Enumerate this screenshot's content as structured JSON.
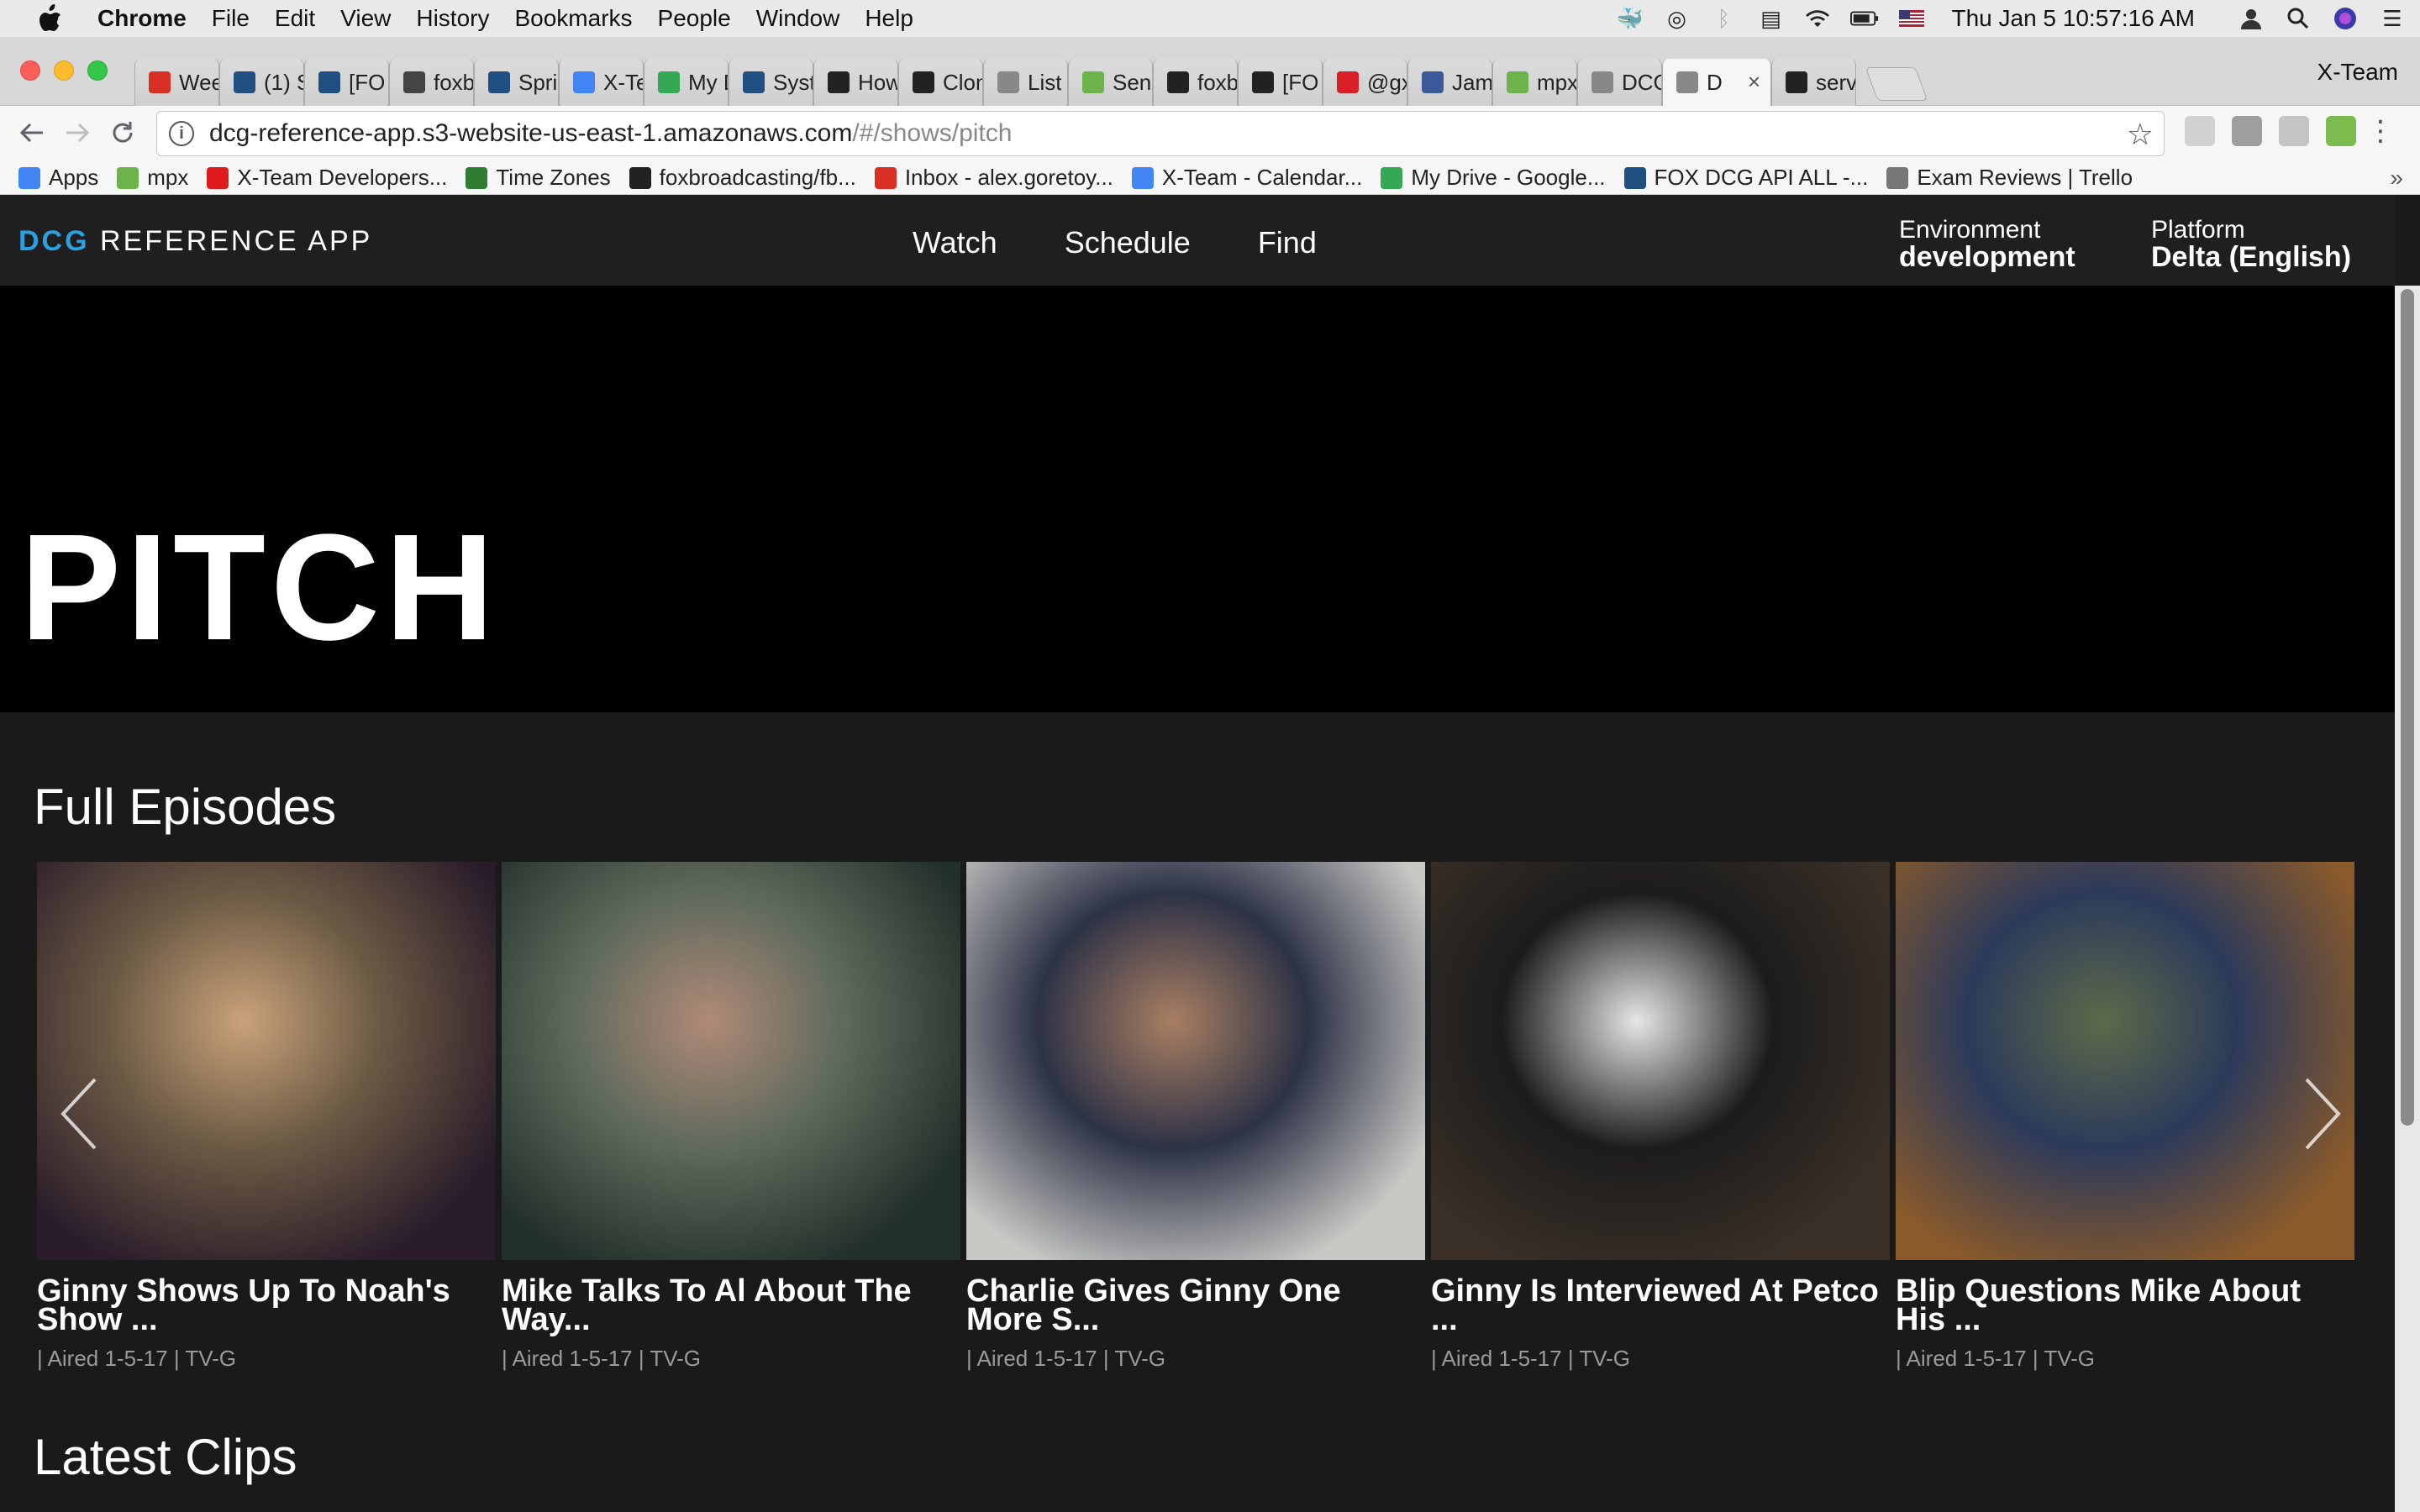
{
  "menubar": {
    "app": "Chrome",
    "items": [
      "File",
      "Edit",
      "View",
      "History",
      "Bookmarks",
      "People",
      "Window",
      "Help"
    ],
    "clock": "Thu Jan 5  10:57:16 AM"
  },
  "tabs": [
    {
      "title": "Wee",
      "icon": "gmail-icon",
      "color": "#d93025"
    },
    {
      "title": "(1) S",
      "icon": "jira-icon",
      "color": "#205081"
    },
    {
      "title": "[FO",
      "icon": "jira-icon",
      "color": "#205081"
    },
    {
      "title": "foxb",
      "icon": "circle-icon",
      "color": "#444444"
    },
    {
      "title": "Spri",
      "icon": "jira-icon",
      "color": "#205081"
    },
    {
      "title": "X-Te",
      "icon": "calendar-icon",
      "color": "#4285f4"
    },
    {
      "title": "My D",
      "icon": "drive-icon",
      "color": "#34a853"
    },
    {
      "title": "Syst",
      "icon": "jira-icon",
      "color": "#205081"
    },
    {
      "title": "How",
      "icon": "github-icon",
      "color": "#222222"
    },
    {
      "title": "Clon",
      "icon": "github-icon",
      "color": "#222222"
    },
    {
      "title": "List",
      "icon": "page-icon",
      "color": "#888888"
    },
    {
      "title": "Sens",
      "icon": "sensu-icon",
      "color": "#6bb34a"
    },
    {
      "title": "foxb",
      "icon": "github-icon",
      "color": "#222222"
    },
    {
      "title": "[FO",
      "icon": "github-icon",
      "color": "#222222"
    },
    {
      "title": "@gx",
      "icon": "netflix-icon",
      "color": "#d81f26"
    },
    {
      "title": "Jam",
      "icon": "facebook-icon",
      "color": "#3b5998"
    },
    {
      "title": "mpx",
      "icon": "mpx-icon",
      "color": "#6bb34a"
    },
    {
      "title": "DCG",
      "icon": "page-icon",
      "color": "#888888"
    },
    {
      "title": "D",
      "icon": "page-icon",
      "color": "#888888",
      "active": true
    },
    {
      "title": "serv",
      "icon": "github-icon",
      "color": "#222222"
    }
  ],
  "profile_name": "X-Team",
  "address": {
    "host": "dcg-reference-app.s3-website-us-east-1.amazonaws.com",
    "path": "/#/shows/pitch"
  },
  "bookmarks": [
    {
      "label": "Apps",
      "icon": "apps-grid-icon",
      "color": "#4285f4"
    },
    {
      "label": "mpx",
      "icon": "mpx-icon",
      "color": "#6bb34a"
    },
    {
      "label": "X-Team Developers...",
      "icon": "xteam-icon",
      "color": "#e01b1b"
    },
    {
      "label": "Time Zones",
      "icon": "timezones-icon",
      "color": "#2e7d32"
    },
    {
      "label": "foxbroadcasting/fb...",
      "icon": "github-icon",
      "color": "#222222"
    },
    {
      "label": "Inbox - alex.goretoy...",
      "icon": "gmail-icon",
      "color": "#d93025"
    },
    {
      "label": "X-Team - Calendar...",
      "icon": "calendar-icon",
      "color": "#4285f4"
    },
    {
      "label": "My Drive - Google...",
      "icon": "drive-icon",
      "color": "#34a853"
    },
    {
      "label": "FOX DCG API ALL -...",
      "icon": "jira-icon",
      "color": "#205081"
    },
    {
      "label": "Exam Reviews | Trello",
      "icon": "trello-icon",
      "color": "#777777"
    }
  ],
  "app": {
    "logo_brand": "DCG",
    "logo_rest": "REFERENCE APP",
    "nav": [
      "Watch",
      "Schedule",
      "Find"
    ],
    "env_label": "Environment",
    "env_value": "development",
    "platform_label": "Platform",
    "platform_value": "Delta (English)"
  },
  "show_title": "PITCH",
  "sections": {
    "full_episodes": "Full Episodes",
    "latest_clips": "Latest Clips"
  },
  "episodes": [
    {
      "title": "Ginny Shows Up To Noah's Show ...",
      "meta": "| Aired 1-5-17 | TV-G",
      "scene_colors": [
        "#2a1c2a",
        "#6b5a44",
        "#c9a27a"
      ]
    },
    {
      "title": "Mike Talks To Al About The Way...",
      "meta": "| Aired 1-5-17 | TV-G",
      "scene_colors": [
        "#22302a",
        "#5e6a5c",
        "#b08a78"
      ]
    },
    {
      "title": "Charlie Gives Ginny One More S...",
      "meta": "| Aired 1-5-17 | TV-G",
      "scene_colors": [
        "#c8c8c4",
        "#2d3246",
        "#a87f62"
      ]
    },
    {
      "title": "Ginny Is Interviewed At Petco ...",
      "meta": "| Aired 1-5-17 | TV-G",
      "scene_colors": [
        "#3a3028",
        "#1c1c1c",
        "#e6e6e6"
      ]
    },
    {
      "title": "Blip Questions Mike About His ...",
      "meta": "| Aired 1-5-17 | TV-G",
      "scene_colors": [
        "#8a5a2a",
        "#2c3a5a",
        "#5c6a4a"
      ]
    }
  ],
  "colors": {
    "brand_accent": "#2aa0e0",
    "header_bg": "#1f1f1f",
    "page_bg": "#1a1a1a"
  }
}
